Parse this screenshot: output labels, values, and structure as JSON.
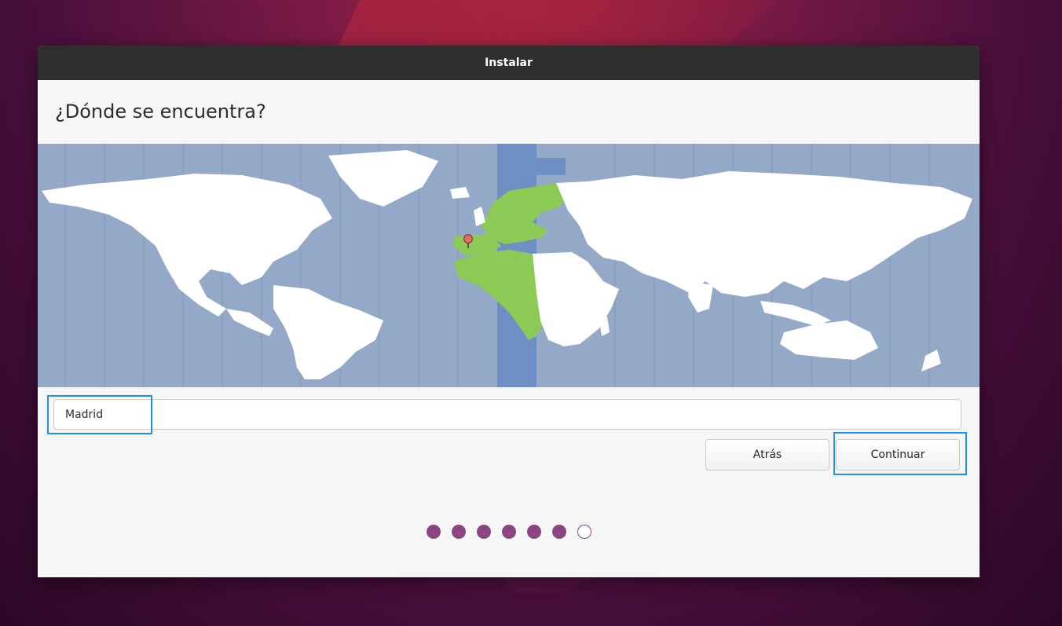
{
  "window": {
    "title": "Instalar"
  },
  "page": {
    "heading": "¿Dónde se encuentra?"
  },
  "location": {
    "value": "Madrid",
    "pin": "location-pin-icon"
  },
  "buttons": {
    "back": "Atrás",
    "continue": "Continuar"
  },
  "progress": {
    "total_steps": 7,
    "completed_steps": 6
  },
  "colors": {
    "map_ocean": "#94a8c7",
    "map_land": "#ffffff",
    "selected_timezone": "#6e8fc4",
    "selected_region": "#8bcb55",
    "progress_dot": "#8b4682",
    "highlight": "#1e90e6"
  }
}
